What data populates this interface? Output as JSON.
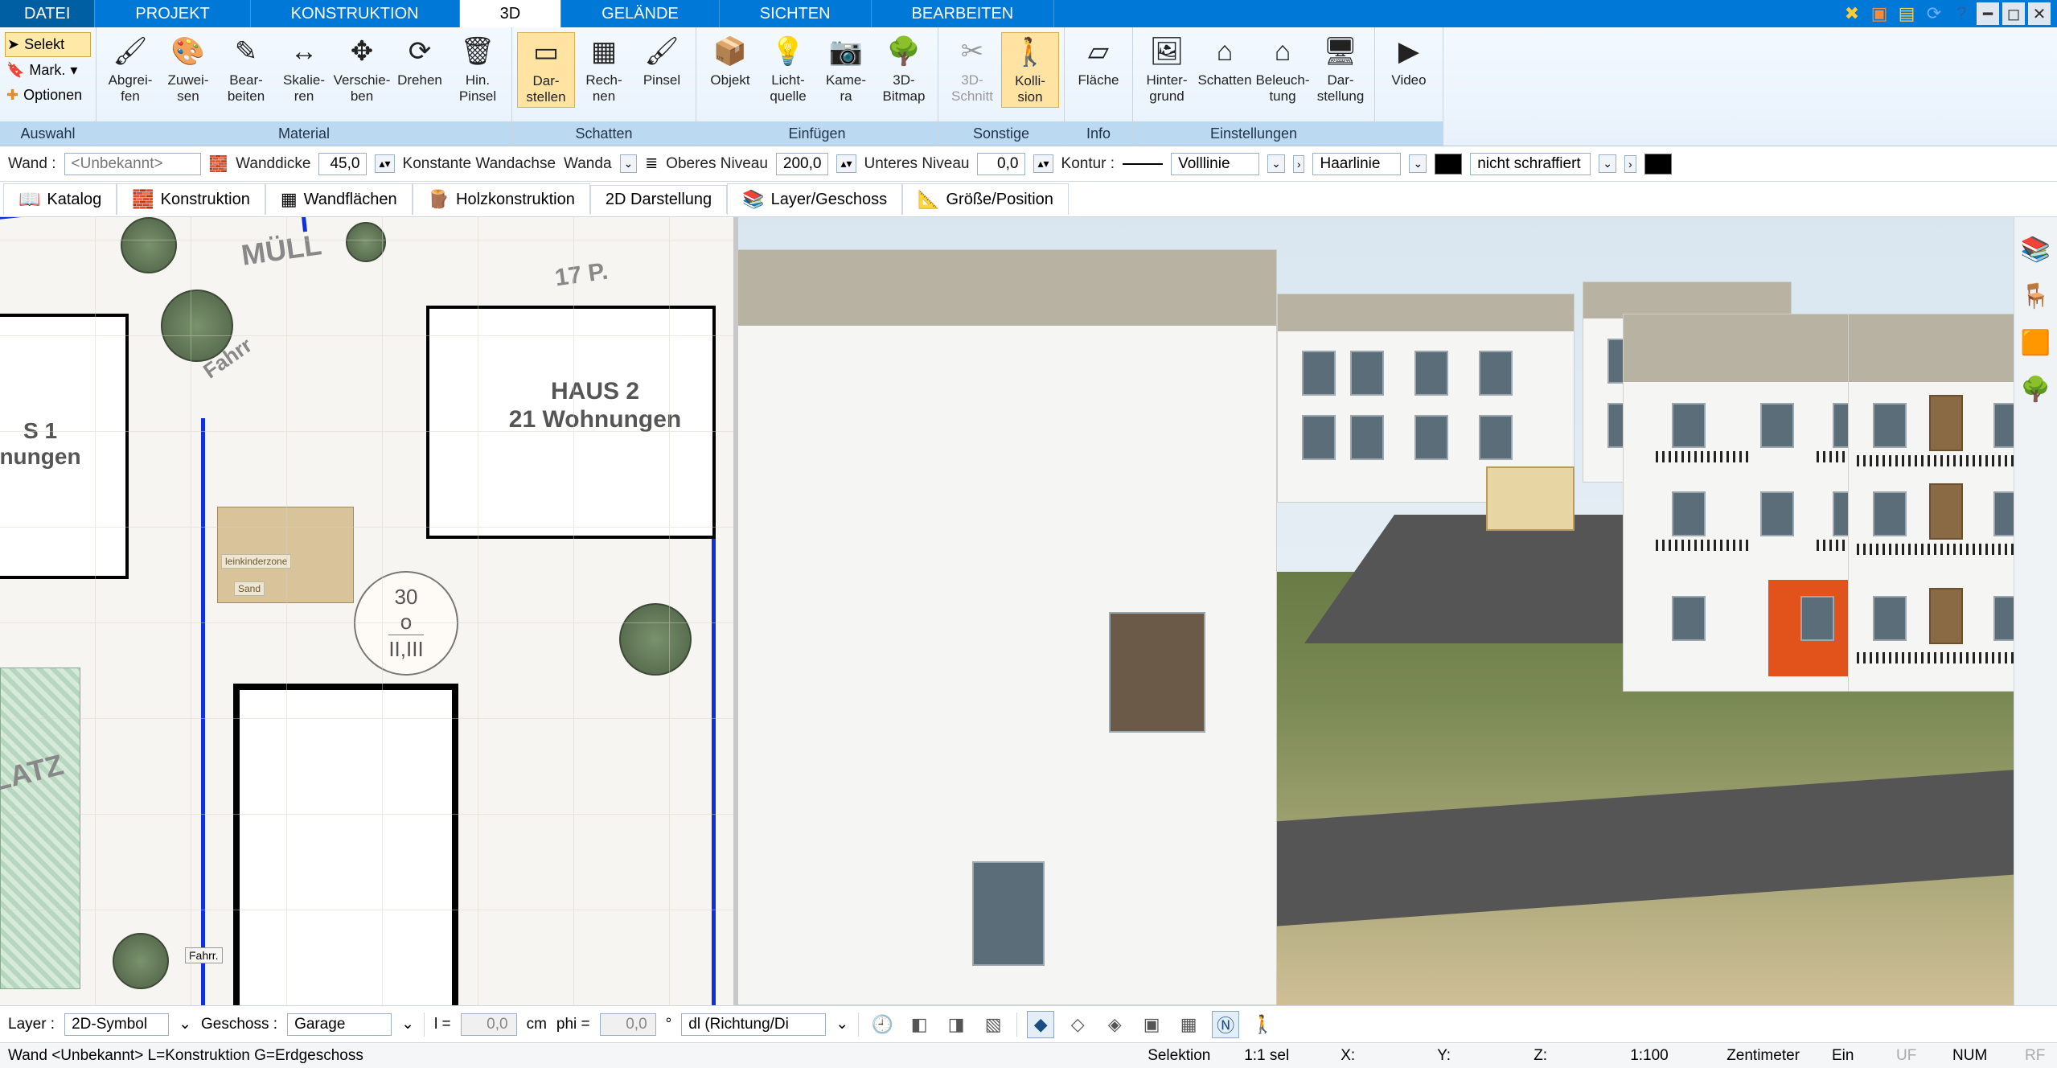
{
  "menuTabs": [
    "DATEI",
    "PROJEKT",
    "KONSTRUKTION",
    "3D",
    "GELÄNDE",
    "SICHTEN",
    "BEARBEITEN"
  ],
  "activeMenuTab": 3,
  "winIcons": [
    "✖",
    "📦",
    "📋",
    "↺",
    "❓"
  ],
  "auswahlCol": {
    "selekt": "Selekt",
    "mark": "Mark.",
    "optionen": "Optionen",
    "label": "Auswahl"
  },
  "ribbonGroups": [
    {
      "label": "Material",
      "items": [
        {
          "icon": "🖌",
          "l1": "Abgrei-",
          "l2": "fen"
        },
        {
          "icon": "🎨",
          "l1": "Zuwei-",
          "l2": "sen"
        },
        {
          "icon": "✎",
          "l1": "Bear-",
          "l2": "beiten"
        },
        {
          "icon": "↔",
          "l1": "Skalie-",
          "l2": "ren"
        },
        {
          "icon": "✥",
          "l1": "Verschie-",
          "l2": "ben"
        },
        {
          "icon": "⟳",
          "l1": "Drehen",
          "l2": ""
        },
        {
          "icon": "🗑",
          "l1": "Hin.",
          "l2": "Pinsel"
        }
      ]
    },
    {
      "label": "Schatten",
      "items": [
        {
          "icon": "▭",
          "l1": "Dar-",
          "l2": "stellen",
          "active": true
        },
        {
          "icon": "▦",
          "l1": "Rech-",
          "l2": "nen"
        },
        {
          "icon": "🖌",
          "l1": "Pinsel",
          "l2": ""
        }
      ]
    },
    {
      "label": "Einfügen",
      "items": [
        {
          "icon": "📦",
          "l1": "Objekt",
          "l2": ""
        },
        {
          "icon": "💡",
          "l1": "Licht-",
          "l2": "quelle"
        },
        {
          "icon": "📷",
          "l1": "Kame-",
          "l2": "ra"
        },
        {
          "icon": "🌳",
          "l1": "3D-",
          "l2": "Bitmap"
        }
      ]
    },
    {
      "label": "Sonstige",
      "items": [
        {
          "icon": "✂",
          "l1": "3D-",
          "l2": "Schnitt",
          "disabled": true
        },
        {
          "icon": "🚶",
          "l1": "Kolli-",
          "l2": "sion",
          "active": true
        }
      ]
    },
    {
      "label": "Info",
      "items": [
        {
          "icon": "▱",
          "l1": "Fläche",
          "l2": ""
        }
      ]
    },
    {
      "label": "Einstellungen",
      "items": [
        {
          "icon": "🖼",
          "l1": "Hinter-",
          "l2": "grund"
        },
        {
          "icon": "⌂",
          "l1": "Schatten",
          "l2": ""
        },
        {
          "icon": "⌂",
          "l1": "Beleuch-",
          "l2": "tung"
        },
        {
          "icon": "🖥",
          "l1": "Dar-",
          "l2": "stellung"
        }
      ]
    },
    {
      "label": "",
      "items": [
        {
          "icon": "▶",
          "l1": "Video",
          "l2": ""
        }
      ]
    }
  ],
  "propbar": {
    "wand": "Wand :",
    "wandValue": "<Unbekannt>",
    "wanddicke": "Wanddicke",
    "wanddickeVal": "45,0",
    "konst": "Konstante Wandachse",
    "wanda": "Wanda",
    "oberes": "Oberes Niveau",
    "oberesVal": "200,0",
    "unteres": "Unteres Niveau",
    "unteresVal": "0,0",
    "kontur": "Kontur :",
    "linie": "Volllinie",
    "haar": "Haarlinie",
    "schraff": "nicht schraffiert"
  },
  "toolTabs": [
    {
      "icon": "📖",
      "label": "Katalog"
    },
    {
      "icon": "🧱",
      "label": "Konstruktion"
    },
    {
      "icon": "▦",
      "label": "Wandflächen"
    },
    {
      "icon": "🪵",
      "label": "Holzkonstruktion"
    },
    {
      "icon": "",
      "label": "2D Darstellung"
    },
    {
      "icon": "📚",
      "label": "Layer/Geschoss"
    },
    {
      "icon": "📐",
      "label": "Größe/Position"
    }
  ],
  "plan2d": {
    "muell": "MÜLL",
    "p17": "17 P.",
    "haus2a": "HAUS 2",
    "haus2b": "21 Wohnungen",
    "s1": "S 1",
    "nungen": "nungen",
    "fahrr": "Fahrr",
    "latz": "LATZ",
    "circle1": "30",
    "circle2": "o",
    "circle3": "II,III",
    "kinder": "leinkinderzone",
    "sand": "Sand",
    "fahrr2": "Fahrr."
  },
  "bottombar": {
    "layer": "Layer :",
    "layerVal": "2D-Symbol",
    "geschoss": "Geschoss :",
    "geschossVal": "Garage",
    "l": "l =",
    "lVal": "0,0",
    "cm": "cm",
    "phi": "phi =",
    "phiVal": "0,0",
    "deg": "°",
    "dl": "dl (Richtung/Di"
  },
  "status": {
    "left": "Wand <Unbekannt> L=Konstruktion G=Erdgeschoss",
    "sel": "Selektion",
    "ratio": "1:1 sel",
    "x": "X:",
    "y": "Y:",
    "z": "Z:",
    "scale": "1:100",
    "unit": "Zentimeter",
    "ein": "Ein",
    "uf": "UF",
    "num": "NUM",
    "rf": "RF"
  }
}
